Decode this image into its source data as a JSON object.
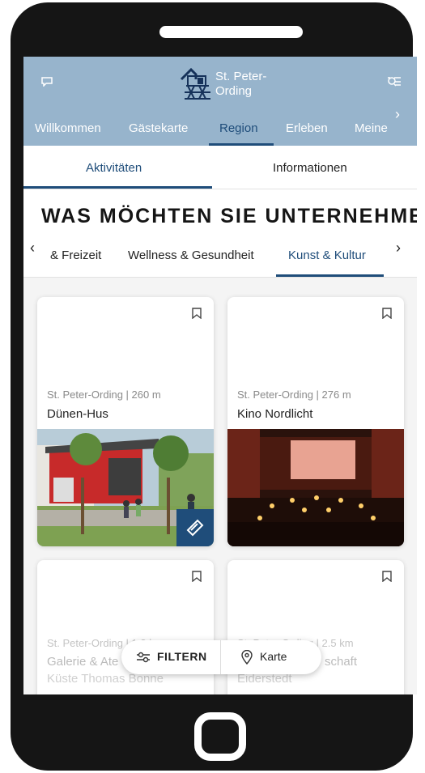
{
  "header": {
    "brand_line1": "St. Peter-",
    "brand_line2": "Ording",
    "nav": [
      "Willkommen",
      "Gästekarte",
      "Region",
      "Erleben",
      "Meine"
    ],
    "active_nav": "Region",
    "chat_icon": "chat-icon",
    "filter_icon": "filter-search-icon",
    "accent": "#97b4cc"
  },
  "subtabs": {
    "a": "Aktivitäten",
    "b": "Informationen"
  },
  "headline": "WAS MÖCHTEN SIE UNTERNEHMEN?",
  "categories": [
    "& Freizeit",
    "Wellness & Gesundheit",
    "Kunst & Kultur"
  ],
  "active_category": "Kunst & Kultur",
  "cards": [
    {
      "meta": "St. Peter-Ording | 260 m",
      "title": "Dünen-Hus"
    },
    {
      "meta": "St. Peter-Ording | 276 m",
      "title": "Kino Nordlicht"
    },
    {
      "meta": "St. Peter-Ording | 1.3 k",
      "title": "Galerie & Ate",
      "subtitle": "Küste Thomas Bonne"
    },
    {
      "meta": "St. Peter-Ording | 2.5 km",
      "title": "schaft",
      "subtitle": "Eiderstedt"
    }
  ],
  "fab": {
    "filter": "FILTERN",
    "map": "Karte"
  },
  "colors": {
    "primary": "#1f4d7a",
    "frame": "#151515"
  }
}
